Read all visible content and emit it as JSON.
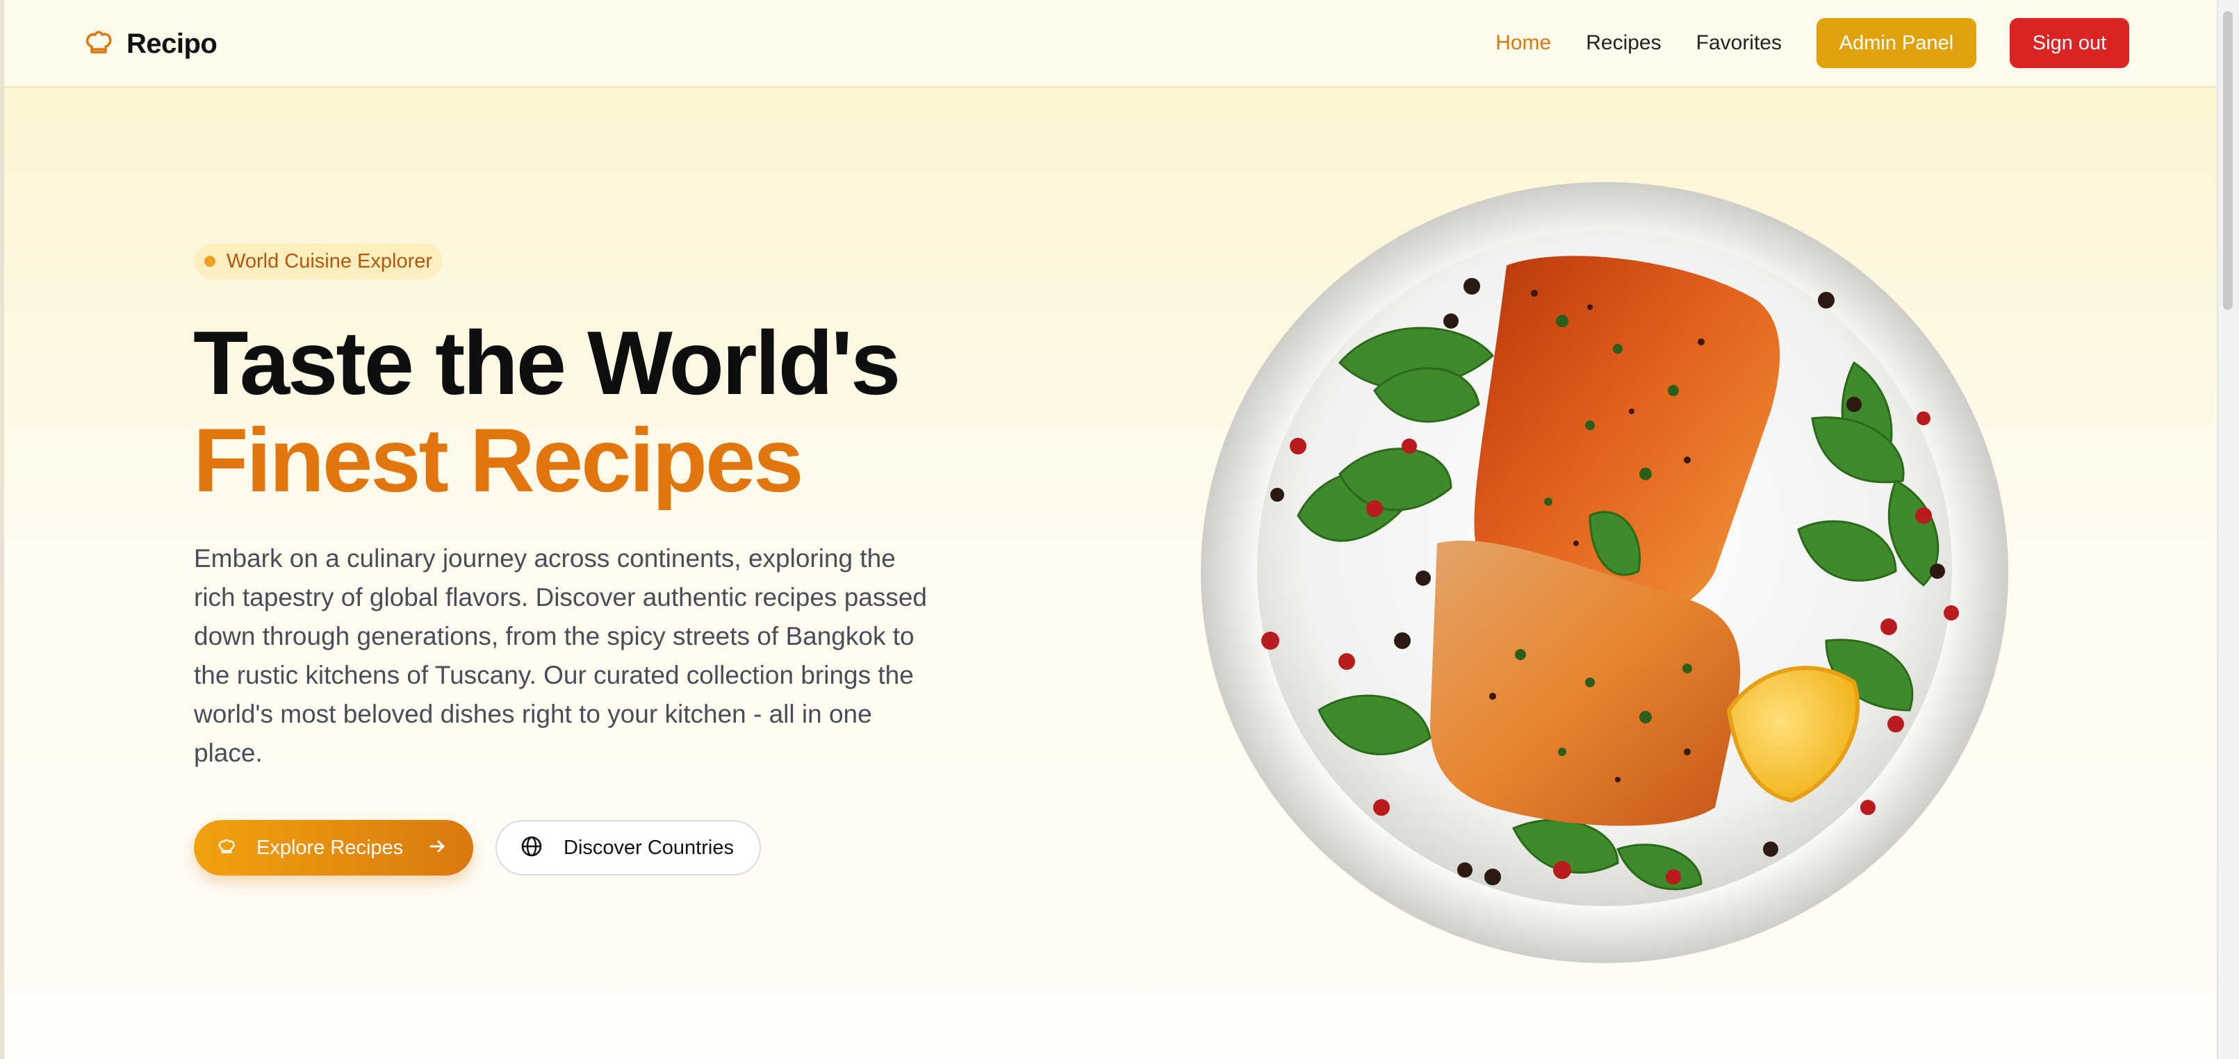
{
  "brand": {
    "name": "Recipo",
    "icon": "chef-hat-icon"
  },
  "nav": {
    "links": [
      {
        "label": "Home",
        "active": true
      },
      {
        "label": "Recipes",
        "active": false
      },
      {
        "label": "Favorites",
        "active": false
      }
    ],
    "admin_label": "Admin Panel",
    "signout_label": "Sign out"
  },
  "hero": {
    "badge": "World Cuisine Explorer",
    "title_line1": "Taste the World's",
    "title_line2": "Finest Recipes",
    "description": "Embark on a culinary journey across continents, exploring the rich tapestry of global flavors. Discover authentic recipes passed down through generations, from the spicy streets of Bangkok to the rustic kitchens of Tuscany. Our curated collection brings the world's most beloved dishes right to your kitchen - all in one place.",
    "primary_button": "Explore Recipes",
    "secondary_button": "Discover Countries"
  },
  "colors": {
    "accent": "#e1760e",
    "admin": "#e0a20d",
    "danger": "#dc2424",
    "heading": "#0e0e0e",
    "body_text": "#4a4d57"
  },
  "icons": [
    "chef-hat-icon",
    "arrow-right-icon",
    "globe-icon"
  ]
}
